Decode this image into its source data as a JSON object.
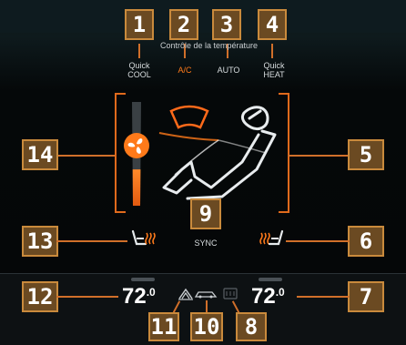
{
  "title": "Contrôle de la température",
  "buttons": {
    "quick_cool": "Quick\nCOOL",
    "ac": "A/C",
    "auto": "AUTO",
    "quick_heat": "Quick\nHEAT",
    "sync": "SYNC"
  },
  "temps": {
    "left": "72",
    "left_unit": ".0",
    "right": "72",
    "right_unit": ".0"
  },
  "markers": [
    "1",
    "2",
    "3",
    "4",
    "5",
    "6",
    "7",
    "8",
    "9",
    "10",
    "11",
    "12",
    "13",
    "14"
  ],
  "colors": {
    "accent": "#ff7a1a",
    "tag_fill": "#6b4a22",
    "tag_border": "#c98a3c",
    "line": "#d06f2a"
  },
  "icons": {
    "fan": "fan-icon",
    "seat_heat_left": "seat-heat-left-icon",
    "seat_heat_right": "seat-heat-right-icon",
    "windshield_defrost": "front-defrost-icon",
    "recirculation": "recirculation-icon",
    "rear_defrost": "rear-defrost-icon",
    "airflow_seat": "airflow-seat-icon"
  },
  "fan_level": 0.35
}
